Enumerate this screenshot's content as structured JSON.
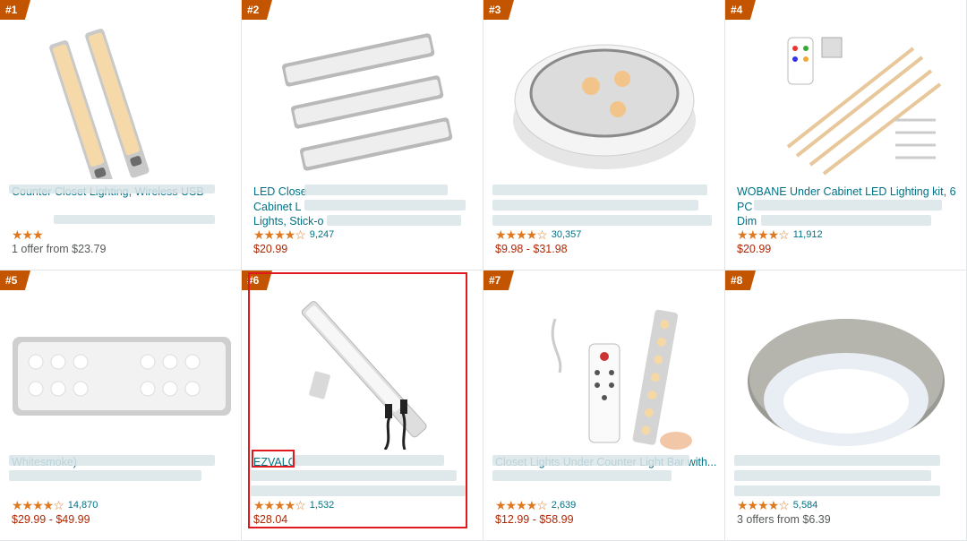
{
  "colors": {
    "badge": "#c45500",
    "link": "#007185",
    "price": "#b12704",
    "star": "#de7921",
    "highlight": "#e0191f"
  },
  "products": [
    {
      "rank": "#1",
      "lines": [
        "Counter Closet Lighting, Wireless USB",
        "",
        ""
      ],
      "stars": "★★★",
      "count": "",
      "offer_prefix": "1 offer from ",
      "offer_price": "$23.79",
      "price": ""
    },
    {
      "rank": "#2",
      "lines": [
        "LED Close",
        "Cabinet L",
        "Lights, Stick-o"
      ],
      "stars": "★★★★☆",
      "count": "9,247",
      "price": "$20.99"
    },
    {
      "rank": "#3",
      "lines": [
        "",
        "",
        ""
      ],
      "stars": "★★★★☆",
      "count": "30,357",
      "price": "$9.98 - $31.98"
    },
    {
      "rank": "#4",
      "lines": [
        "WOBANE Under Cabinet LED Lighting kit, 6",
        "PC",
        "Dim"
      ],
      "stars": "★★★★☆",
      "count": "11,912",
      "price": "$20.99"
    },
    {
      "rank": "#5",
      "lines": [
        "",
        "",
        "Whitesmoke)"
      ],
      "stars": "★★★★☆",
      "count": "14,870",
      "price": "$29.99 - $49.99"
    },
    {
      "rank": "#6",
      "lines": [
        "EZVALO",
        "",
        ""
      ],
      "stars": "★★★★☆",
      "count": "1,532",
      "price": "$28.04"
    },
    {
      "rank": "#7",
      "lines": [
        "",
        "",
        "Closet Lights Under Counter Light Bar with..."
      ],
      "stars": "★★★★☆",
      "count": "2,639",
      "price": "$12.99 - $58.99"
    },
    {
      "rank": "#8",
      "lines": [
        "",
        "",
        ""
      ],
      "stars": "★★★★☆",
      "count": "5,584",
      "offer_prefix": "3 offers from ",
      "offer_price": "$6.39",
      "price": ""
    }
  ]
}
